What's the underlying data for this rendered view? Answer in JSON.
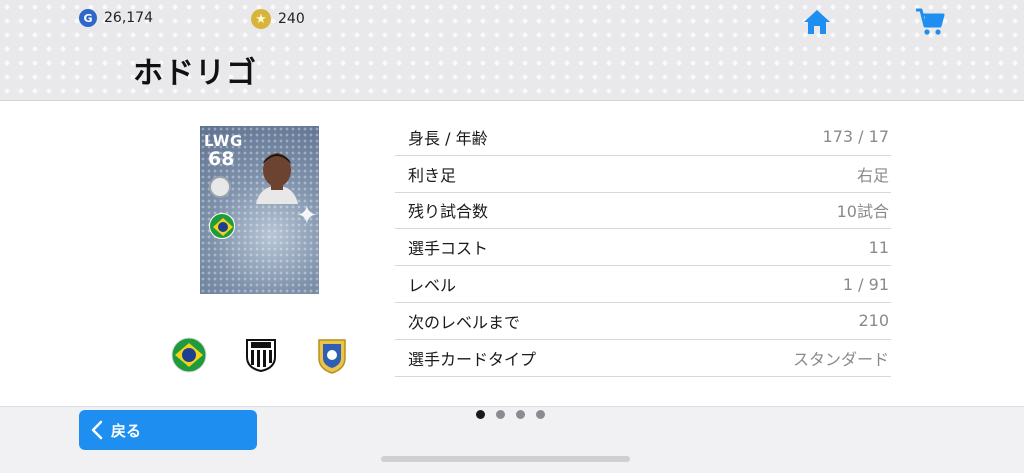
{
  "header": {
    "gp_amount": "26,174",
    "coin_amount": "240",
    "title": "ホドリゴ",
    "accent_color": "#1e8ef0"
  },
  "card": {
    "position": "LWG",
    "rating": "68"
  },
  "badges": [
    "brazil-flag-icon",
    "santos-crest-icon",
    "league-badge-icon"
  ],
  "stats": [
    {
      "label": "身長 / 年齢",
      "value": "173 / 17"
    },
    {
      "label": "利き足",
      "value": "右足"
    },
    {
      "label": "残り試合数",
      "value": "10試合"
    },
    {
      "label": "選手コスト",
      "value": "11"
    },
    {
      "label": "レベル",
      "value": "1 / 91"
    },
    {
      "label": "次のレベルまで",
      "value": "210"
    },
    {
      "label": "選手カードタイプ",
      "value": "スタンダード"
    }
  ],
  "pager": {
    "pages": 4,
    "active": 1
  },
  "footer": {
    "back_label": "戻る"
  }
}
